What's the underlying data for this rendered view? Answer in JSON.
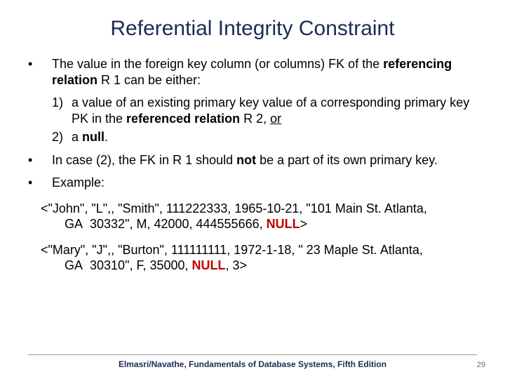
{
  "title": "Referential Integrity Constraint",
  "bullets": [
    {
      "mark": "•",
      "html": "The value in the foreign key column (or columns) FK of the <span class=\"bold\">referencing relation</span> R 1 can be either:"
    }
  ],
  "numbered": [
    {
      "mark": "1)",
      "html": "a value of an existing primary key value of a corresponding primary key PK in the <span class=\"bold\">referenced relation</span> R 2, <span class=\"underline\">or</span>"
    },
    {
      "mark": "2)",
      "html": "a <span class=\"bold\">null</span>."
    }
  ],
  "bullets2": [
    {
      "mark": "•",
      "html": "In case (2), the FK in R 1 should <span class=\"bold\">not</span> be a part of its own primary key."
    },
    {
      "mark": "•",
      "html": "Example:"
    }
  ],
  "examples": [
    {
      "html": "&lt;\"John\", \"L\",, \"Smith\", 111222333, 1965-10-21, \"101 Main St. Atlanta, GA&nbsp;&nbsp;30332\", M, 42000, 444555666, <span class=\"null\">NULL</span>&gt;"
    },
    {
      "html": "&lt;\"Mary\", \"J\",, \"Burton\", 111111111, 1972-1-18, \" 23 Maple St. Atlanta, GA&nbsp;&nbsp;30310\", F, 35000, <span class=\"null\">NULL</span>, 3&gt;"
    }
  ],
  "footer": "Elmasri/Navathe, Fundamentals of Database Systems, Fifth Edition",
  "page": "29"
}
